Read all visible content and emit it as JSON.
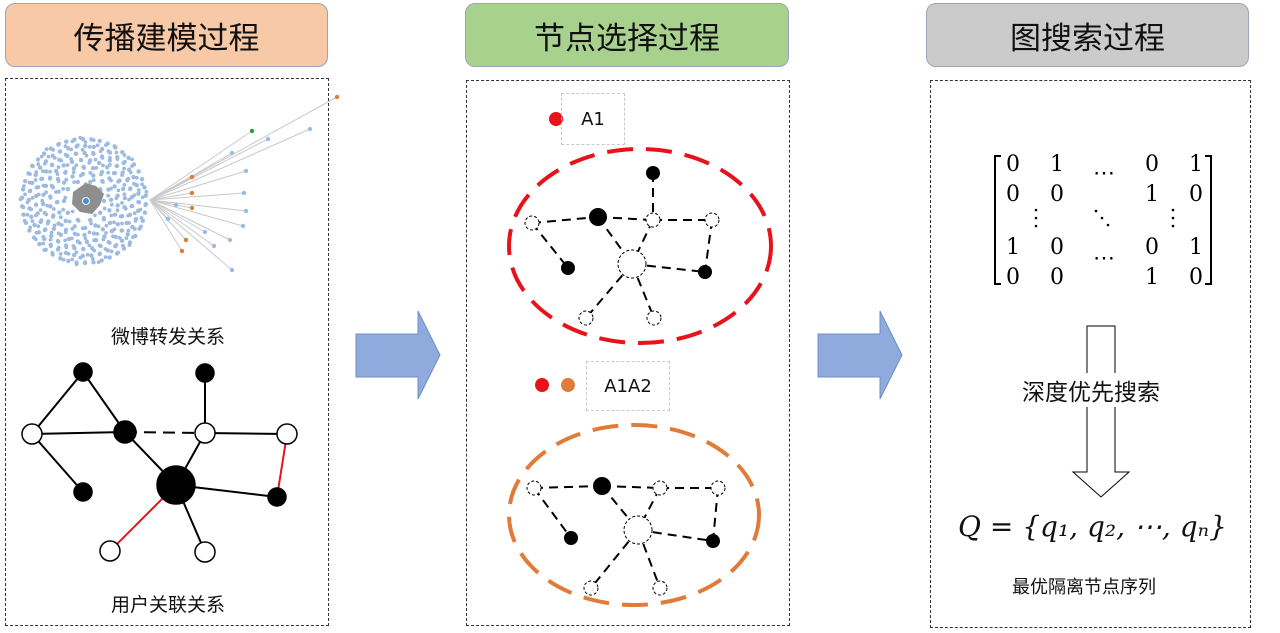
{
  "stages": {
    "modeling_title": "传播建模过程",
    "selection_title": "节点选择过程",
    "search_title": "图搜索过程"
  },
  "panel1": {
    "weibo_label": "微博转发关系",
    "user_label": "用户关联关系"
  },
  "panel2": {
    "legend1": "A1",
    "legend2": "A1A2"
  },
  "panel3": {
    "matrix": [
      [
        "0",
        "1",
        "⋯",
        "0",
        "1"
      ],
      [
        "0",
        "0",
        "⋯",
        "1",
        "0"
      ],
      [
        "1",
        "0",
        "⋯",
        "0",
        "1"
      ],
      [
        "0",
        "0",
        "⋯",
        "1",
        "0"
      ]
    ],
    "dfs_label": "深度优先搜索",
    "formula": "Q = {q₁, q₂, ⋯, qₙ}",
    "result_label": "最优隔离节点序列"
  },
  "colors": {
    "red": "#e8121b",
    "orange": "#e07b39",
    "arrow_fill": "#8faadc",
    "dot_blue": "#9dbbe0"
  }
}
